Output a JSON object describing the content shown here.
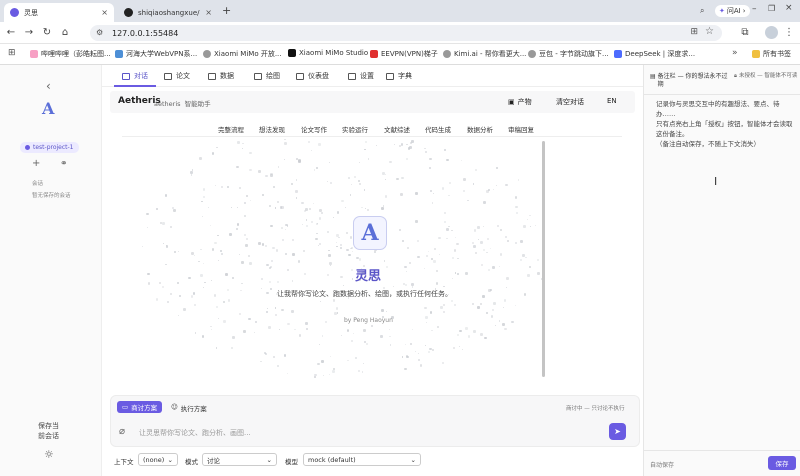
{
  "browser": {
    "tabs": [
      {
        "title": "灵思",
        "icon": "app-icon"
      },
      {
        "title": "shiqiaoshangxue/aethe",
        "icon": "github-icon"
      }
    ],
    "new_tab": "+",
    "url": "127.0.0.1:55484",
    "profile_label": "问AI",
    "bookmarks": [
      "哔哩哔哩（彭皓耘图...",
      "河海大学WebVPN系...",
      "Xiaomi MiMo 开放...",
      "Xiaomi MiMo Studio",
      "EEVPN(VPN)梯子",
      "Kimi.ai - 帮你看更大...",
      "豆包 - 字节跳动旗下...",
      "DeepSeek | 深度求..."
    ],
    "all_bookmarks": "所有书签",
    "more": "»"
  },
  "sidebar": {
    "back": "‹",
    "logo": "A",
    "project": "test-project-1",
    "add": "+",
    "link": "⚭",
    "session_label": "会话",
    "no_session": "暂无保存的会话",
    "save_session": "保存当\n前会话",
    "theme": "☼"
  },
  "nav": {
    "tabs": [
      "对话",
      "论文",
      "数据",
      "绘图",
      "仪表盘",
      "设置",
      "字典"
    ]
  },
  "header": {
    "title": "Aetheris",
    "subtitle": "aetheris  智能助手",
    "product_btn": "产物",
    "clear_btn": "清空对话",
    "lang_btn": "EN"
  },
  "subtabs": [
    "完整流程",
    "想法发现",
    "论文写作",
    "实验运行",
    "文献综述",
    "代码生成",
    "数据分析",
    "审稿回复"
  ],
  "hero": {
    "logo": "A",
    "title": "灵思",
    "tagline": "让我帮你写论文、跑数据分析、绘图，或执行任何任务。",
    "byline": "by Peng Haoyun"
  },
  "composer": {
    "mode_discuss": "商讨方案",
    "mode_execute": "执行方案",
    "hint": "商讨中 — 只讨论不执行",
    "placeholder": "让灵思帮你写论文、跑分析、画图...",
    "send": "➤"
  },
  "footer": {
    "context_label": "上下文",
    "context_value": "(none)",
    "mode_label": "模式",
    "mode_value": "讨论",
    "model_label": "模型",
    "model_value": "mock (default)"
  },
  "notes": {
    "title": "备注栏 — 你的想法永不过期",
    "status": "未授权 — 智能体不可读",
    "body": "记录你与灵思交互中的有趣想法、要点、待办……\n只有点亮右上角「授权」按钮，智能体才会读取这份备注。\n（备注自动保存，不随上下文消失）",
    "autosave": "自动保存",
    "save": "保存"
  },
  "colors": {
    "accent": "#6a5be2",
    "accent_light": "#eceaff",
    "brand_blue": "#5b6fd8"
  }
}
